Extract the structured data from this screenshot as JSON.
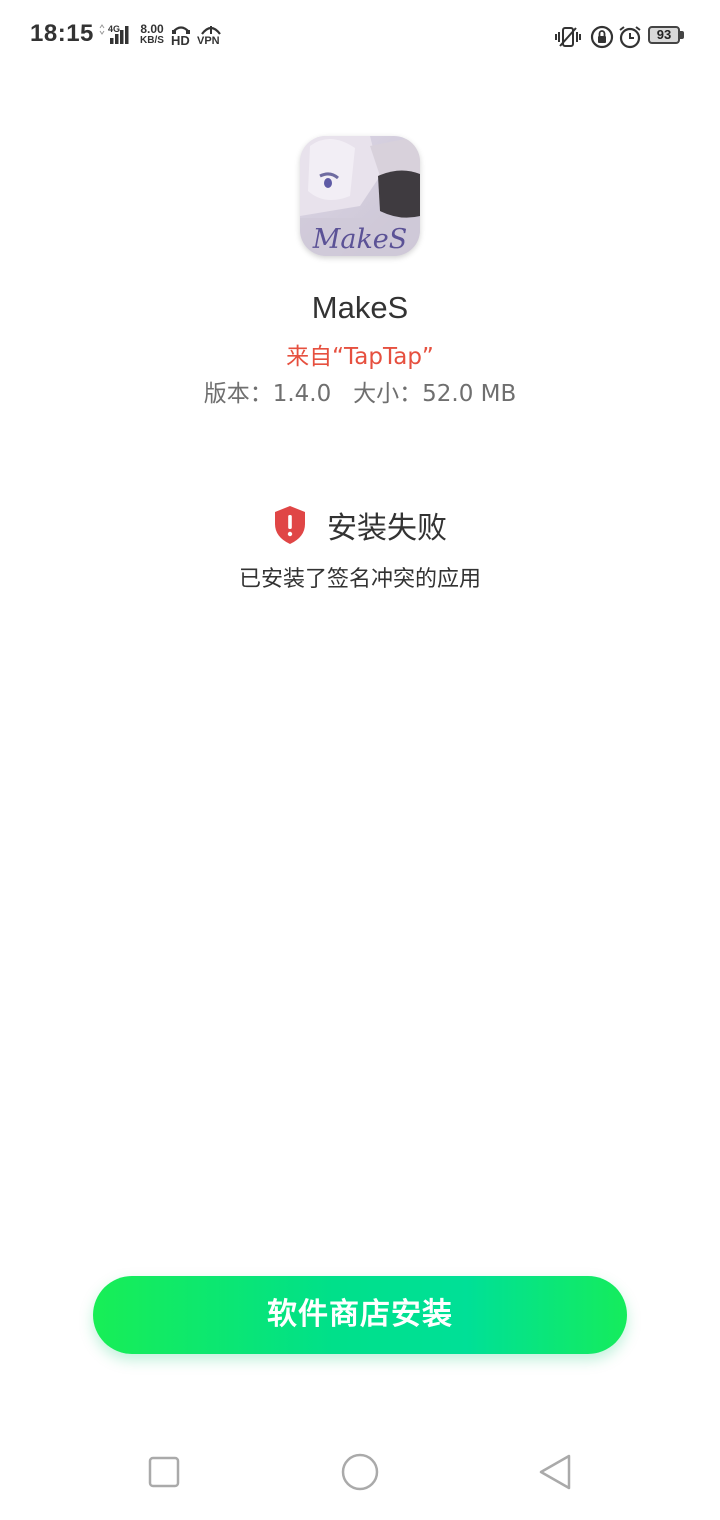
{
  "status_bar": {
    "time": "18:15",
    "network": "4G",
    "speed_value": "8.00",
    "speed_unit": "KB/S",
    "hd": "HD",
    "vpn": "VPN",
    "battery": "93"
  },
  "app": {
    "name": "MakeS",
    "source": "来自“TapTap”",
    "version_text": "版本：1.4.0",
    "size_text": "大小：52.0 MB",
    "icon_text": "MakeS"
  },
  "error": {
    "title": "安装失败",
    "detail": "已安装了签名冲突的应用"
  },
  "actions": {
    "install_button": "软件商店安装"
  },
  "colors": {
    "source": "#e6503f",
    "error_icon": "#e04646",
    "button_green": "#00e08a"
  },
  "icons": {
    "status_right": [
      "vibrate-icon",
      "rotation-lock-icon",
      "alarm-icon"
    ],
    "nav": [
      "recents-icon",
      "home-icon",
      "back-icon"
    ]
  }
}
